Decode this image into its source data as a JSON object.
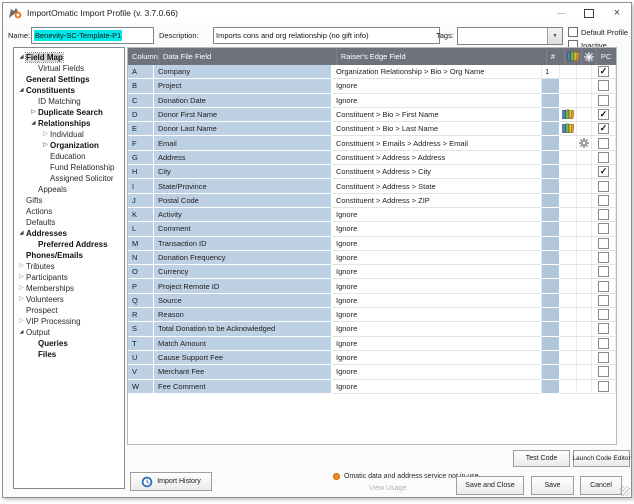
{
  "window": {
    "title": "ImportOmatic Import Profile (v. 3.7.0.66)"
  },
  "form": {
    "name_label": "Name:",
    "name_value": "Benevity-SC-Template-P1",
    "description_label": "Description:",
    "description_value": "Imports cons and org relationship (no gift info)",
    "tags_label": "Tags:",
    "tags_value": "",
    "default_profile_label": "Default Profile",
    "default_profile_checked": false,
    "inactive_label": "Inactive",
    "inactive_checked": false
  },
  "tree": {
    "items": [
      {
        "label": "Field Map",
        "level": 0,
        "bold": true,
        "arrow": "expanded",
        "selected": true
      },
      {
        "label": "Virtual Fields",
        "level": 1
      },
      {
        "label": "General Settings",
        "level": 0,
        "bold": true
      },
      {
        "label": "Constituents",
        "level": 0,
        "bold": true,
        "arrow": "expanded"
      },
      {
        "label": "ID Matching",
        "level": 1
      },
      {
        "label": "Duplicate Search",
        "level": 1,
        "bold": true,
        "arrow": "collapsed"
      },
      {
        "label": "Relationships",
        "level": 1,
        "bold": true,
        "arrow": "expanded"
      },
      {
        "label": "Individual",
        "level": 2,
        "arrow": "collapsed"
      },
      {
        "label": "Organization",
        "level": 2,
        "bold": true,
        "arrow": "collapsed"
      },
      {
        "label": "Education",
        "level": 2
      },
      {
        "label": "Fund Relationship",
        "level": 2
      },
      {
        "label": "Assigned Solicitor",
        "level": 2
      },
      {
        "label": "Appeals",
        "level": 1
      },
      {
        "label": "Gifts",
        "level": 0
      },
      {
        "label": "Actions",
        "level": 0
      },
      {
        "label": "Defaults",
        "level": 0
      },
      {
        "label": "Addresses",
        "level": 0,
        "bold": true,
        "arrow": "expanded"
      },
      {
        "label": "Preferred Address",
        "level": 1,
        "bold": true
      },
      {
        "label": "Phones/Emails",
        "level": 0,
        "bold": true
      },
      {
        "label": "Tributes",
        "level": 0,
        "arrow": "collapsed"
      },
      {
        "label": "Participants",
        "level": 0,
        "arrow": "collapsed"
      },
      {
        "label": "Memberships",
        "level": 0,
        "arrow": "collapsed"
      },
      {
        "label": "Volunteers",
        "level": 0,
        "arrow": "collapsed"
      },
      {
        "label": "Prospect",
        "level": 0
      },
      {
        "label": "VIP Processing",
        "level": 0,
        "arrow": "collapsed"
      },
      {
        "label": "Output",
        "level": 0,
        "arrow": "expanded"
      },
      {
        "label": "Queries",
        "level": 1,
        "bold": true
      },
      {
        "label": "Files",
        "level": 1,
        "bold": true
      }
    ]
  },
  "table": {
    "headers": {
      "column": "Column",
      "data_file_field": "Data File Field",
      "re_field": "Raiser's Edge Field",
      "num": "#",
      "dict_icon": "dictionary-icon",
      "gear_icon": "gear-icon",
      "pc": "PC"
    },
    "rows": [
      {
        "col": "A",
        "field": "Company",
        "re": "Organization Relationship > Bio > Org Name",
        "num": "1",
        "pc": true
      },
      {
        "col": "B",
        "field": "Project",
        "re": "Ignore",
        "pc": false
      },
      {
        "col": "C",
        "field": "Donation Date",
        "re": "Ignore",
        "pc": false
      },
      {
        "col": "D",
        "field": "Donor First Name",
        "re": "Constituent > Bio > First Name",
        "dict": true,
        "pc": true
      },
      {
        "col": "E",
        "field": "Donor Last Name",
        "re": "Constituent > Bio > Last Name",
        "dict": true,
        "pc": true
      },
      {
        "col": "F",
        "field": "Email",
        "re": "Constituent > Emails > Address > Email",
        "gear": true,
        "pc": false
      },
      {
        "col": "G",
        "field": "Address",
        "re": "Constituent > Address > Address",
        "pc": false
      },
      {
        "col": "H",
        "field": "City",
        "re": "Constituent > Address > City",
        "pc": true
      },
      {
        "col": "I",
        "field": "State/Province",
        "re": "Constituent > Address > State",
        "pc": false
      },
      {
        "col": "J",
        "field": "Postal Code",
        "re": "Constituent > Address > ZIP",
        "pc": false
      },
      {
        "col": "K",
        "field": "Activity",
        "re": "Ignore",
        "pc": false
      },
      {
        "col": "L",
        "field": "Comment",
        "re": "Ignore",
        "pc": false
      },
      {
        "col": "M",
        "field": "Transaction ID",
        "re": "Ignore",
        "pc": false
      },
      {
        "col": "N",
        "field": "Donation Frequency",
        "re": "Ignore",
        "pc": false
      },
      {
        "col": "O",
        "field": "Currency",
        "re": "Ignore",
        "pc": false
      },
      {
        "col": "P",
        "field": "Project Remote ID",
        "re": "Ignore",
        "pc": false
      },
      {
        "col": "Q",
        "field": "Source",
        "re": "Ignore",
        "pc": false
      },
      {
        "col": "R",
        "field": "Reason",
        "re": "Ignore",
        "pc": false
      },
      {
        "col": "S",
        "field": "Total Donation to be Acknowledged",
        "re": "Ignore",
        "pc": false
      },
      {
        "col": "T",
        "field": "Match Amount",
        "re": "Ignore",
        "pc": false
      },
      {
        "col": "U",
        "field": "Cause Support Fee",
        "re": "Ignore",
        "pc": false
      },
      {
        "col": "V",
        "field": "Merchant Fee",
        "re": "Ignore",
        "pc": false
      },
      {
        "col": "W",
        "field": "Fee Comment",
        "re": "Ignore",
        "pc": false
      }
    ]
  },
  "footer": {
    "test_code_label": "Test Code",
    "launch_code_editor_label": "Launch Code Editor",
    "import_history_label": "Import History",
    "status_text": "Omatic data and address service not in use",
    "view_usage_label": "View Usage",
    "save_and_close_label": "Save and Close",
    "save_label": "Save",
    "cancel_label": "Cancel"
  },
  "colors": {
    "selection_highlight": "#00e8e8",
    "table_header_bg": "#6e727b",
    "mapped_cell_bg": "#bdd0e4",
    "num_cell_bg": "#b2c7dc",
    "status_dot": "#f08a24",
    "history_icon_blue": "#2f6fb5"
  }
}
